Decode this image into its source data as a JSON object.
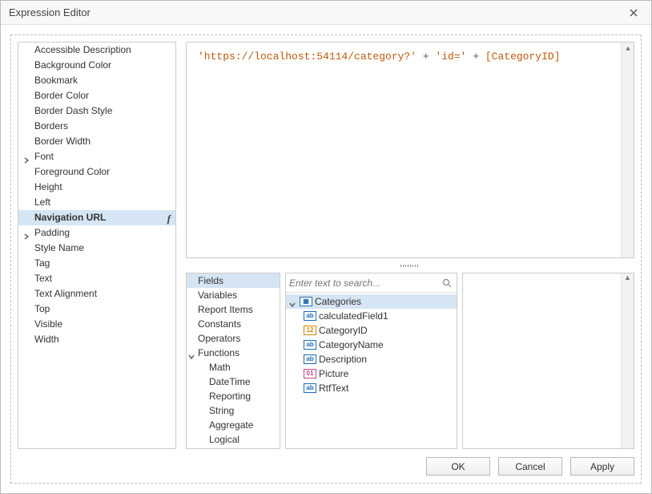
{
  "window": {
    "title": "Expression Editor"
  },
  "properties": [
    {
      "label": "Accessible Description"
    },
    {
      "label": "Background Color"
    },
    {
      "label": "Bookmark"
    },
    {
      "label": "Border Color"
    },
    {
      "label": "Border Dash Style"
    },
    {
      "label": "Borders"
    },
    {
      "label": "Border Width"
    },
    {
      "label": "Font",
      "expandable": true
    },
    {
      "label": "Foreground Color"
    },
    {
      "label": "Height"
    },
    {
      "label": "Left"
    },
    {
      "label": "Navigation URL",
      "selected": true,
      "fx": true
    },
    {
      "label": "Padding",
      "expandable": true
    },
    {
      "label": "Style Name"
    },
    {
      "label": "Tag"
    },
    {
      "label": "Text"
    },
    {
      "label": "Text Alignment"
    },
    {
      "label": "Top"
    },
    {
      "label": "Visible"
    },
    {
      "label": "Width"
    }
  ],
  "expression": {
    "part1": "'https://localhost:54114/category?'",
    "plus": " + ",
    "part2": "'id='",
    "field": "[CategoryID]"
  },
  "categories": [
    {
      "label": "Fields",
      "selected": true
    },
    {
      "label": "Variables"
    },
    {
      "label": "Report Items"
    },
    {
      "label": "Constants"
    },
    {
      "label": "Operators"
    },
    {
      "label": "Functions",
      "expandable": true,
      "expanded": true
    },
    {
      "label": "Math",
      "sub": true
    },
    {
      "label": "DateTime",
      "sub": true
    },
    {
      "label": "Reporting",
      "sub": true
    },
    {
      "label": "String",
      "sub": true
    },
    {
      "label": "Aggregate",
      "sub": true
    },
    {
      "label": "Logical",
      "sub": true
    }
  ],
  "search": {
    "placeholder": "Enter text to search..."
  },
  "tree": {
    "root": {
      "label": "Categories",
      "icon": "table",
      "selected": true,
      "expanded": true
    },
    "children": [
      {
        "label": "calculatedField1",
        "icon": "ab"
      },
      {
        "label": "CategoryID",
        "icon": "12"
      },
      {
        "label": "CategoryName",
        "icon": "ab"
      },
      {
        "label": "Description",
        "icon": "ab"
      },
      {
        "label": "Picture",
        "icon": "01"
      },
      {
        "label": "RtfText",
        "icon": "ab"
      }
    ]
  },
  "buttons": {
    "ok": "OK",
    "cancel": "Cancel",
    "apply": "Apply"
  }
}
